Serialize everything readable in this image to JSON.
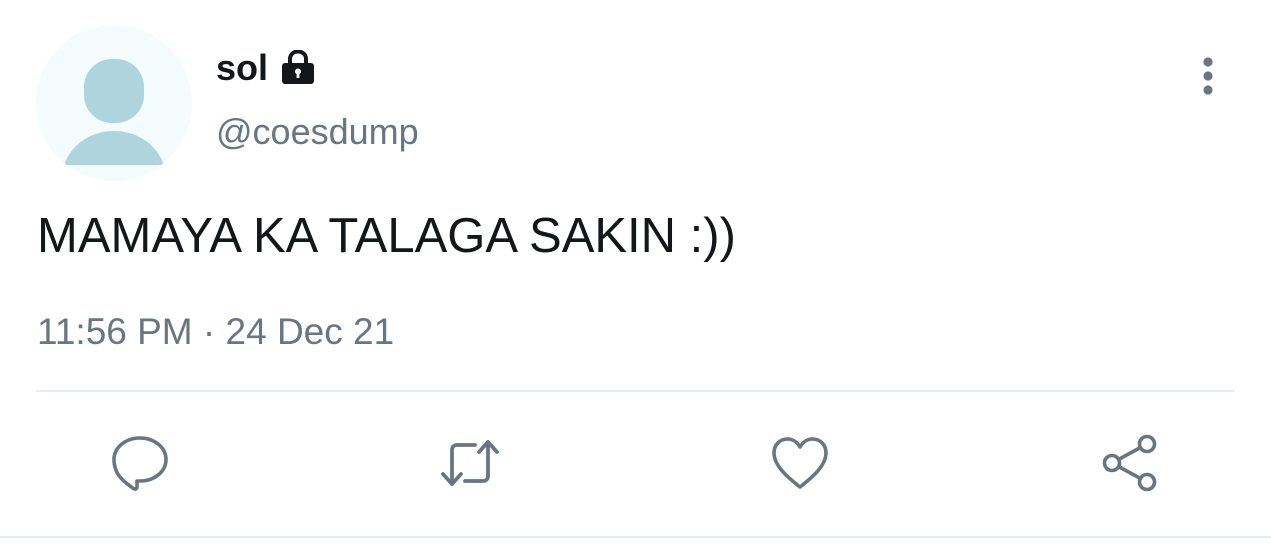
{
  "tweet": {
    "display_name": "sol",
    "handle": "@coesdump",
    "text": "MAMAYA KA TALAGA SAKIN :))",
    "time": "11:56 PM",
    "separator": "·",
    "date": "24 Dec 21",
    "protected": true
  },
  "icons": {
    "lock": "lock-icon",
    "more": "more-vertical-icon",
    "reply": "reply-icon",
    "retweet": "retweet-icon",
    "like": "heart-icon",
    "share": "share-icon"
  },
  "colors": {
    "text_primary": "#14171a",
    "text_secondary": "#687684",
    "avatar_bg": "#f3fbfc",
    "avatar_figure": "#aed5de",
    "divider": "#e6ecf0"
  }
}
